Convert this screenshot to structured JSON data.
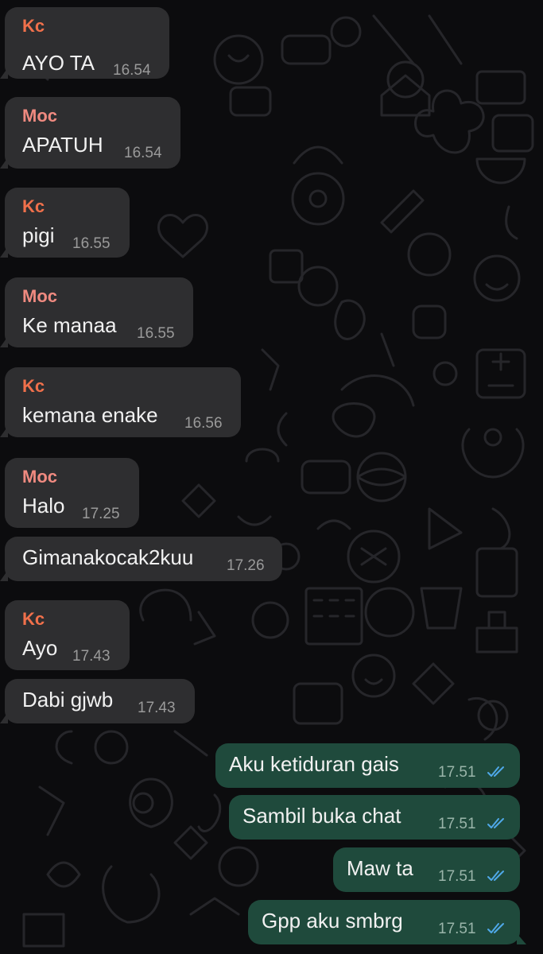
{
  "colors": {
    "background": "#0c0c0e",
    "incoming_bubble": "#2e2e30",
    "outgoing_bubble": "#1f4a3c",
    "sender_kc": "#f0704b",
    "sender_moc": "#f08a80",
    "read_ticks": "#4fa8e8"
  },
  "messages": [
    {
      "direction": "in",
      "sender": "Kc",
      "text": "AYO TA",
      "time": "16.54"
    },
    {
      "direction": "in",
      "sender": "Moc",
      "text": "APATUH",
      "time": "16.54"
    },
    {
      "direction": "in",
      "sender": "Kc",
      "text": "pigi",
      "time": "16.55"
    },
    {
      "direction": "in",
      "sender": "Moc",
      "text": "Ke manaa",
      "time": "16.55"
    },
    {
      "direction": "in",
      "sender": "Kc",
      "text": "kemana enake",
      "time": "16.56"
    },
    {
      "direction": "in",
      "sender": "Moc",
      "text": "Halo",
      "time": "17.25"
    },
    {
      "direction": "in",
      "sender": "",
      "text": "Gimanakocak2kuu",
      "time": "17.26"
    },
    {
      "direction": "in",
      "sender": "Kc",
      "text": "Ayo",
      "time": "17.43"
    },
    {
      "direction": "in",
      "sender": "",
      "text": "Dabi gjwb",
      "time": "17.43"
    },
    {
      "direction": "out",
      "sender": "",
      "text": "Aku ketiduran gais",
      "time": "17.51",
      "status": "read-double-check-icon"
    },
    {
      "direction": "out",
      "sender": "",
      "text": "Sambil buka chat",
      "time": "17.51",
      "status": "read-double-check-icon"
    },
    {
      "direction": "out",
      "sender": "",
      "text": "Maw ta",
      "time": "17.51",
      "status": "read-double-check-icon"
    },
    {
      "direction": "out",
      "sender": "",
      "text": "Gpp aku smbrg",
      "time": "17.51",
      "status": "read-double-check-icon"
    }
  ]
}
